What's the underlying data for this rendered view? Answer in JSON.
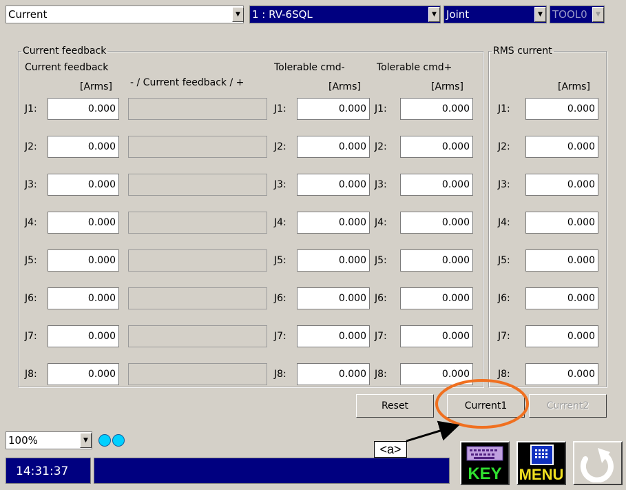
{
  "topbar": {
    "mode": "Current",
    "robot": "1 : RV-6SQL",
    "coord": "Joint",
    "tool": "TOOL0"
  },
  "feedback_group": {
    "legend": "Current feedback",
    "col1_title": "Current feedback",
    "col1_unit": "[Arms]",
    "col2_title": "- / Current feedback / +",
    "col3_title": "Tolerable cmd-",
    "col3_unit": "[Arms]",
    "col4_title": "Tolerable cmd+",
    "col4_unit": "[Arms]"
  },
  "rms_group": {
    "legend": "RMS current",
    "unit": "[Arms]"
  },
  "rows": [
    {
      "joint": "J1:",
      "feedback": "0.000",
      "tol_minus": "0.000",
      "tol_plus": "0.000",
      "rms": "0.000"
    },
    {
      "joint": "J2:",
      "feedback": "0.000",
      "tol_minus": "0.000",
      "tol_plus": "0.000",
      "rms": "0.000"
    },
    {
      "joint": "J3:",
      "feedback": "0.000",
      "tol_minus": "0.000",
      "tol_plus": "0.000",
      "rms": "0.000"
    },
    {
      "joint": "J4:",
      "feedback": "0.000",
      "tol_minus": "0.000",
      "tol_plus": "0.000",
      "rms": "0.000"
    },
    {
      "joint": "J5:",
      "feedback": "0.000",
      "tol_minus": "0.000",
      "tol_plus": "0.000",
      "rms": "0.000"
    },
    {
      "joint": "J6:",
      "feedback": "0.000",
      "tol_minus": "0.000",
      "tol_plus": "0.000",
      "rms": "0.000"
    },
    {
      "joint": "J7:",
      "feedback": "0.000",
      "tol_minus": "0.000",
      "tol_plus": "0.000",
      "rms": "0.000"
    },
    {
      "joint": "J8:",
      "feedback": "0.000",
      "tol_minus": "0.000",
      "tol_plus": "0.000",
      "rms": "0.000"
    }
  ],
  "buttons": {
    "reset": "Reset",
    "current1": "Current1",
    "current2": "Current2"
  },
  "bottom": {
    "speed": "100%",
    "time": "14:31:37",
    "status": "",
    "key_label": "KEY",
    "menu_label": "MENU"
  },
  "annotation": {
    "label": "<a>"
  },
  "colors": {
    "background": "#d4d0c8",
    "selected": "#000080",
    "highlight_circle": "#f07020",
    "indicator": "#00d0ff"
  }
}
